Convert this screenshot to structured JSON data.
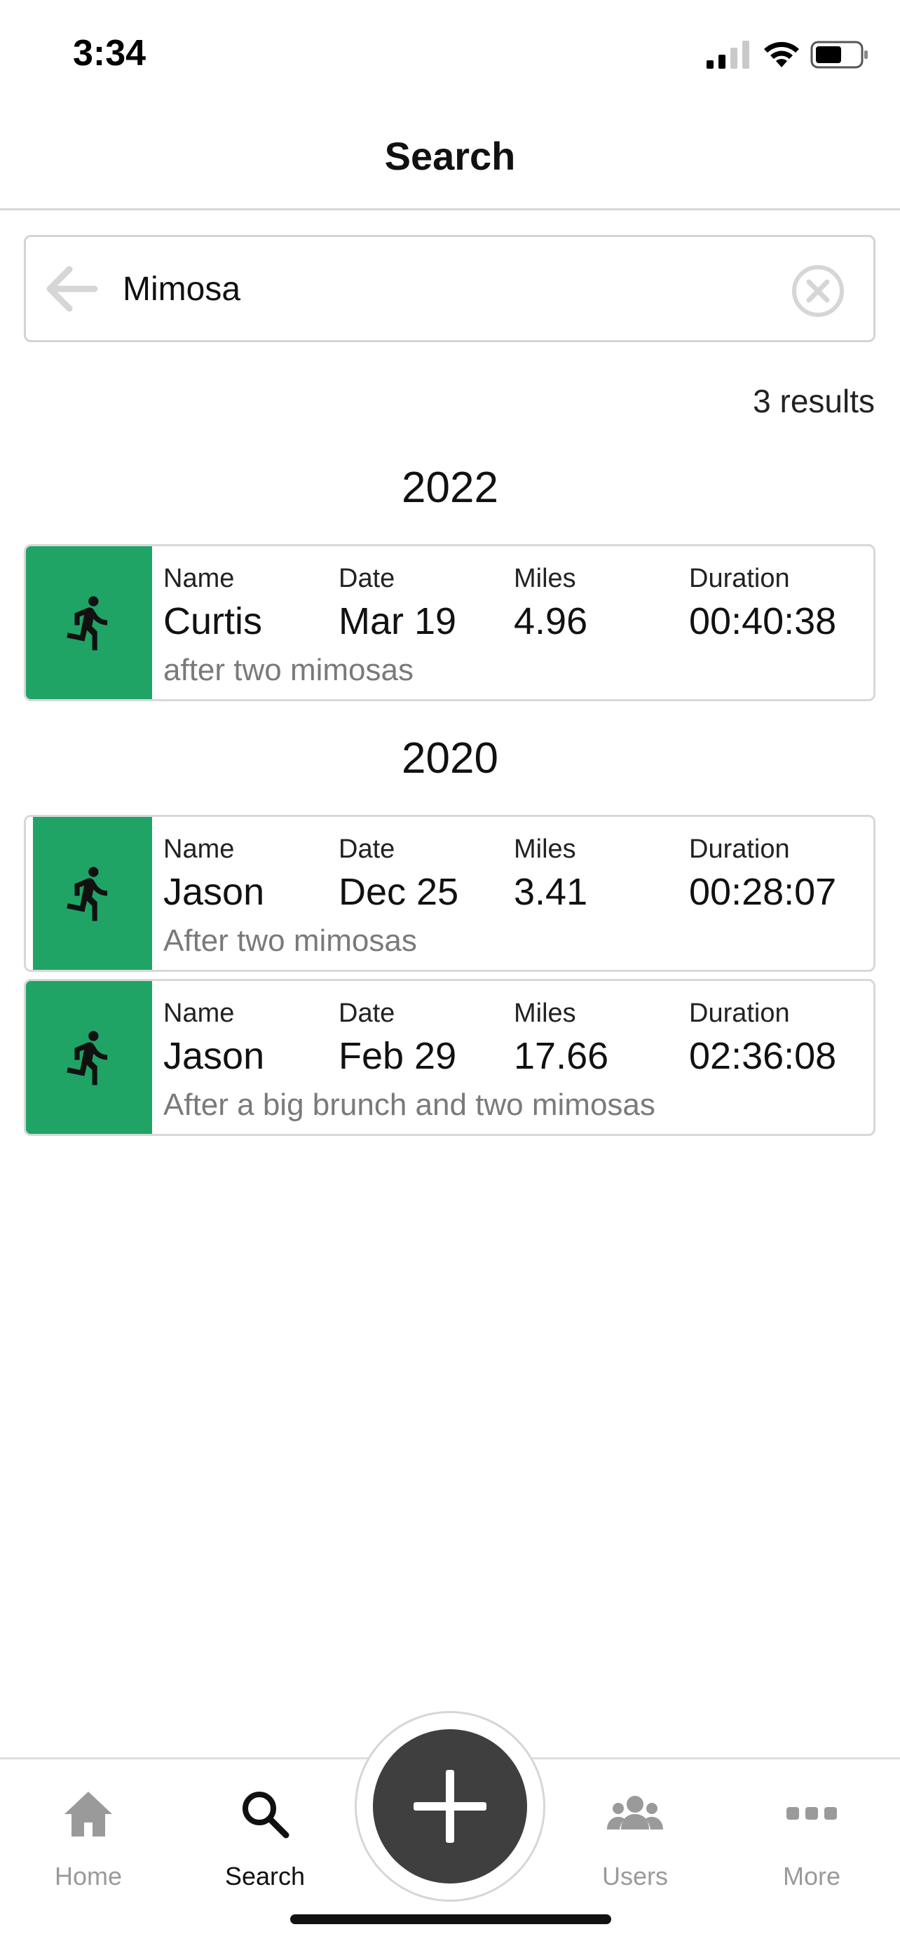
{
  "status_bar": {
    "time": "3:34"
  },
  "header": {
    "title": "Search"
  },
  "search": {
    "value": "Mimosa"
  },
  "results": {
    "count_text": "3 results"
  },
  "groups": [
    {
      "year": "2022",
      "entries": [
        {
          "name_label": "Name",
          "name": "Curtis",
          "date_label": "Date",
          "date": "Mar 19",
          "miles_label": "Miles",
          "miles": "4.96",
          "duration_label": "Duration",
          "duration": "00:40:38",
          "note": "after two mimosas"
        }
      ]
    },
    {
      "year": "2020",
      "entries": [
        {
          "name_label": "Name",
          "name": "Jason",
          "date_label": "Date",
          "date": "Dec 25",
          "miles_label": "Miles",
          "miles": "3.41",
          "duration_label": "Duration",
          "duration": "00:28:07",
          "note": "After two mimosas"
        },
        {
          "name_label": "Name",
          "name": "Jason",
          "date_label": "Date",
          "date": "Feb 29",
          "miles_label": "Miles",
          "miles": "17.66",
          "duration_label": "Duration",
          "duration": "02:36:08",
          "note": "After a big brunch and two mimosas"
        }
      ]
    }
  ],
  "tab_bar": {
    "home": "Home",
    "search": "Search",
    "users": "Users",
    "more": "More",
    "active": "Search"
  },
  "colors": {
    "accent": "#1fa465",
    "fab": "#3f3f3f"
  }
}
